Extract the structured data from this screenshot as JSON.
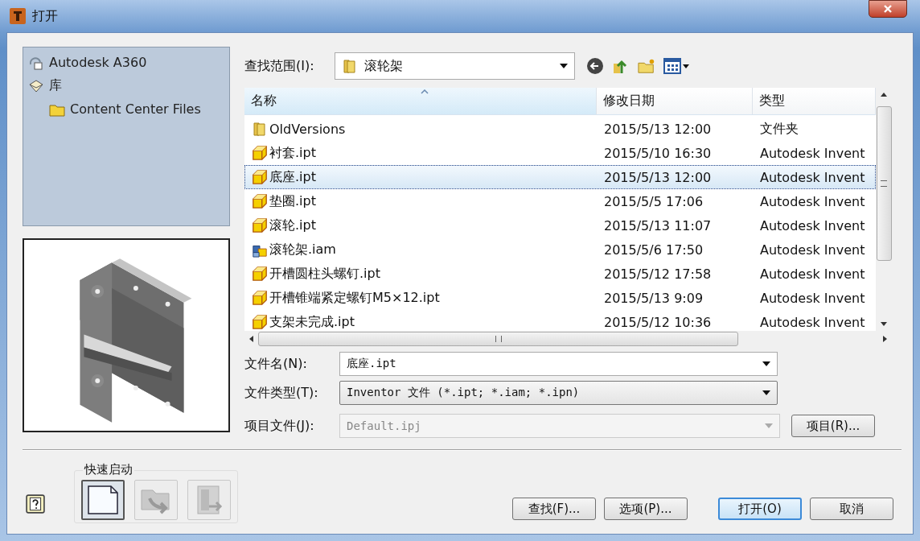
{
  "window": {
    "title": "打开"
  },
  "places": [
    {
      "label": "Autodesk A360",
      "kind": "cloud"
    },
    {
      "label": "库",
      "kind": "library",
      "children": [
        {
          "label": "Content Center Files",
          "kind": "folder"
        }
      ]
    }
  ],
  "look_in": {
    "label": "查找范围(I):",
    "value": "滚轮架"
  },
  "file_list": {
    "columns": [
      {
        "label": "名称",
        "sorted": true
      },
      {
        "label": "修改日期",
        "sorted": false
      },
      {
        "label": "类型",
        "sorted": false
      }
    ],
    "rows": [
      {
        "name": "OldVersions",
        "kind": "folder",
        "modified": "2015/5/13 12:00",
        "type": "文件夹",
        "selected": false
      },
      {
        "name": "衬套.ipt",
        "kind": "part",
        "modified": "2015/5/10 16:30",
        "type": "Autodesk Invent",
        "selected": false
      },
      {
        "name": "底座.ipt",
        "kind": "part",
        "modified": "2015/5/13 12:00",
        "type": "Autodesk Invent",
        "selected": true
      },
      {
        "name": "垫圈.ipt",
        "kind": "part",
        "modified": "2015/5/5 17:06",
        "type": "Autodesk Invent",
        "selected": false
      },
      {
        "name": "滚轮.ipt",
        "kind": "part",
        "modified": "2015/5/13 11:07",
        "type": "Autodesk Invent",
        "selected": false
      },
      {
        "name": "滚轮架.iam",
        "kind": "assembly",
        "modified": "2015/5/6 17:50",
        "type": "Autodesk Invent",
        "selected": false
      },
      {
        "name": "开槽圆柱头螺钉.ipt",
        "kind": "part",
        "modified": "2015/5/12 17:58",
        "type": "Autodesk Invent",
        "selected": false
      },
      {
        "name": "开槽锥端紧定螺钉M5×12.ipt",
        "kind": "part",
        "modified": "2015/5/13 9:09",
        "type": "Autodesk Invent",
        "selected": false
      },
      {
        "name": "支架未完成.ipt",
        "kind": "part",
        "modified": "2015/5/12 10:36",
        "type": "Autodesk Invent",
        "selected": false
      }
    ]
  },
  "file_name": {
    "label": "文件名(N):",
    "value": "底座.ipt"
  },
  "file_type": {
    "label": "文件类型(T):",
    "value": "Inventor 文件 (*.ipt; *.iam; *.ipn)"
  },
  "project_file": {
    "label": "项目文件(J):",
    "value": "Default.ipj",
    "disabled": true
  },
  "project_button": {
    "label": "项目(R)..."
  },
  "quick_launch": {
    "title": "快速启动",
    "items": [
      {
        "kind": "new",
        "selected": true,
        "disabled": false
      },
      {
        "kind": "open",
        "selected": false,
        "disabled": true
      },
      {
        "kind": "import",
        "selected": false,
        "disabled": true
      }
    ]
  },
  "buttons": [
    {
      "label": "查找(F)...",
      "default": false
    },
    {
      "label": "选项(P)...",
      "default": false
    },
    {
      "label": "打开(O)",
      "default": true
    },
    {
      "label": "取消",
      "default": false
    }
  ]
}
